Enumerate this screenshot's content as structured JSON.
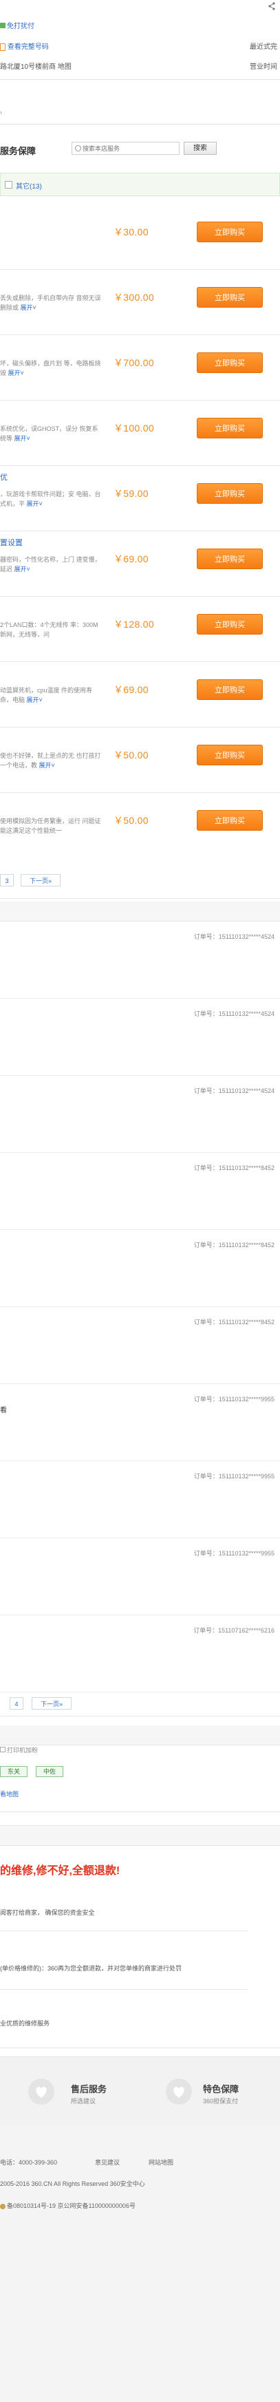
{
  "top": {
    "share_icon": "share-icon",
    "feature_link": "免打扰付",
    "check_link": "查看完整号码",
    "nearest_label": "最近式完",
    "address_text": "路北厦10号楼前商 地图",
    "business_label": "营业时间"
  },
  "service": {
    "title": "服务保障",
    "search_placeholder": "搜索本店服务",
    "search_button": "搜索",
    "filter_label": "其它(13)"
  },
  "products": [
    {
      "title": "",
      "desc": "",
      "expand": "",
      "price": "￥30.00",
      "buy": "立即购买"
    },
    {
      "title": "",
      "desc": "丢失或删除，手机自带内存 音频无误删除或",
      "expand": "展开",
      "price": "￥300.00",
      "buy": "立即购买"
    },
    {
      "title": "",
      "desc": "坏，磁头偏移，盘片划 等，电路板烧毁",
      "expand": "展开",
      "price": "￥700.00",
      "buy": "立即购买"
    },
    {
      "title": "",
      "desc": "系统优化，误GHOST，误分 恢复系统等",
      "expand": "展开",
      "price": "￥100.00",
      "buy": "立即购买"
    },
    {
      "title": "优",
      "desc": "，玩游戏卡帮软件问题；安 电脑，台式机，平",
      "expand": "展开",
      "price": "￥59.00",
      "buy": "立即购买"
    },
    {
      "title": "置设置",
      "desc": "器密码，个性化名称，上门 速变慢，延迟",
      "expand": "展开",
      "price": "￥69.00",
      "buy": "立即购买"
    },
    {
      "title": "",
      "desc": "2个LAN口数：4个无线传 率：300M新网，无线等，问",
      "expand": "",
      "price": "￥128.00",
      "buy": "立即购买"
    },
    {
      "title": "",
      "desc": "动蓝屏死机，cpu温度 件的使用寿命，电脑",
      "expand": "展开",
      "price": "￥69.00",
      "buy": "立即购买"
    },
    {
      "title": "",
      "desc": "使也不好弹，就上是点的无 也打孩打一个电话，教",
      "expand": "展开",
      "price": "￥50.00",
      "buy": "立即购买"
    },
    {
      "title": "",
      "desc": "使用模拟因为任务繁重，运行 问题证能这满足这个性能统一",
      "expand": "",
      "price": "￥50.00",
      "buy": "立即购买"
    }
  ],
  "pager1": {
    "page": "3",
    "next": "下一页»"
  },
  "orders": [
    {
      "id": "订单号：151110132*****4524"
    },
    {
      "id": "订单号：151110132*****4524"
    },
    {
      "id": "订单号：151110132*****4524"
    },
    {
      "id": "订单号：151110132*****8452"
    },
    {
      "id": "订单号：151110132*****8452"
    },
    {
      "id": "订单号：151110132*****8452"
    },
    {
      "id": "订单号：151110132*****9955"
    },
    {
      "id": "订单号：151110132*****9955"
    },
    {
      "id": "订单号：151110132*****9955"
    },
    {
      "id": "订单号：151107162*****6216"
    }
  ],
  "order_side_label": "看",
  "pager2": {
    "page": "4",
    "next": "下一页»"
  },
  "extra": {
    "print_label": "打印机加粉",
    "tag_east": "东关",
    "tag_middle": "中佐",
    "map_link": "看地图"
  },
  "guarantee": {
    "headline": "的维修,修不好,全额退款!",
    "line1": "阅客打给商家，  确保您的资金安全",
    "line2": "(单价格维修的)：360再为您全额退款，并对您单维的商家进行处罚",
    "line3": "业优质的维修服务"
  },
  "badges": [
    {
      "icon": "after-sales-heart-icon",
      "title": "售后服务",
      "sub": "所选建议"
    },
    {
      "icon": "special-guarantee-heart-icon",
      "title": "特色保障",
      "sub": "360担保支付"
    }
  ],
  "footer": {
    "hotline": "电话：4000-399-360",
    "feedback": "意见建议",
    "sitemap": "网站地图",
    "copyright": "2005-2016 360.CN All Rights Reserved 360安全中心",
    "icp": "备08010314号-19   京公网安备110000000006号"
  },
  "colors": {
    "accent_orange": "#f57c13",
    "link_blue": "#2e6bc7",
    "tag_green": "#2c7d29"
  }
}
